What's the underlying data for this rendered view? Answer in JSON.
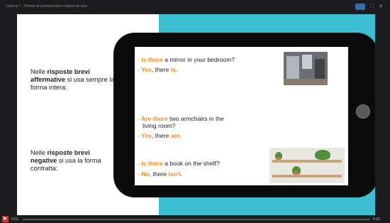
{
  "window": {
    "title": "Lezione 7 - Parlare di arredamento e stanze di casa",
    "badge_color": "#2f6fb0"
  },
  "slide": {
    "notes": [
      {
        "prefix": "Nelle ",
        "bold": "risposte brevi affermative",
        "suffix": " si usa sempre la forma intera:"
      },
      {
        "prefix": "Nelle ",
        "bold": "risposte brevi negative",
        "suffix": " si usa la forma contratta:"
      }
    ],
    "lines": {
      "q1": {
        "dash": "- ",
        "hl": "Is there",
        "rest": " a mirror in your bedroom?"
      },
      "a1": {
        "dash": "- ",
        "hl": "Yes",
        "mid": ", there ",
        "hl2": "is",
        "end": "."
      },
      "q2": {
        "dash": "- ",
        "hl": "Are there",
        "rest": " two armchairs in the"
      },
      "q2b": "living room?",
      "a2": {
        "dash": "- ",
        "hl": "Yes",
        "mid": ", there ",
        "hl2": "are",
        "end": "."
      },
      "q3": {
        "dash": "- ",
        "hl": "Is there",
        "rest": " a book on the shelf?"
      },
      "a3": {
        "dash": "- ",
        "hl": "No",
        "mid": ", there ",
        "hl2": "isn't",
        "end": "."
      }
    },
    "images": [
      "bedroom-photo",
      "shelf-photo"
    ],
    "colors": {
      "accent": "#f28c1e",
      "cyan": "#3bbfd1",
      "tablet": "#0b0b0b"
    }
  },
  "player": {
    "time_current": "0:01",
    "time_total": "8:15",
    "progress_fraction": 0.0,
    "accent": "#d6322f"
  }
}
